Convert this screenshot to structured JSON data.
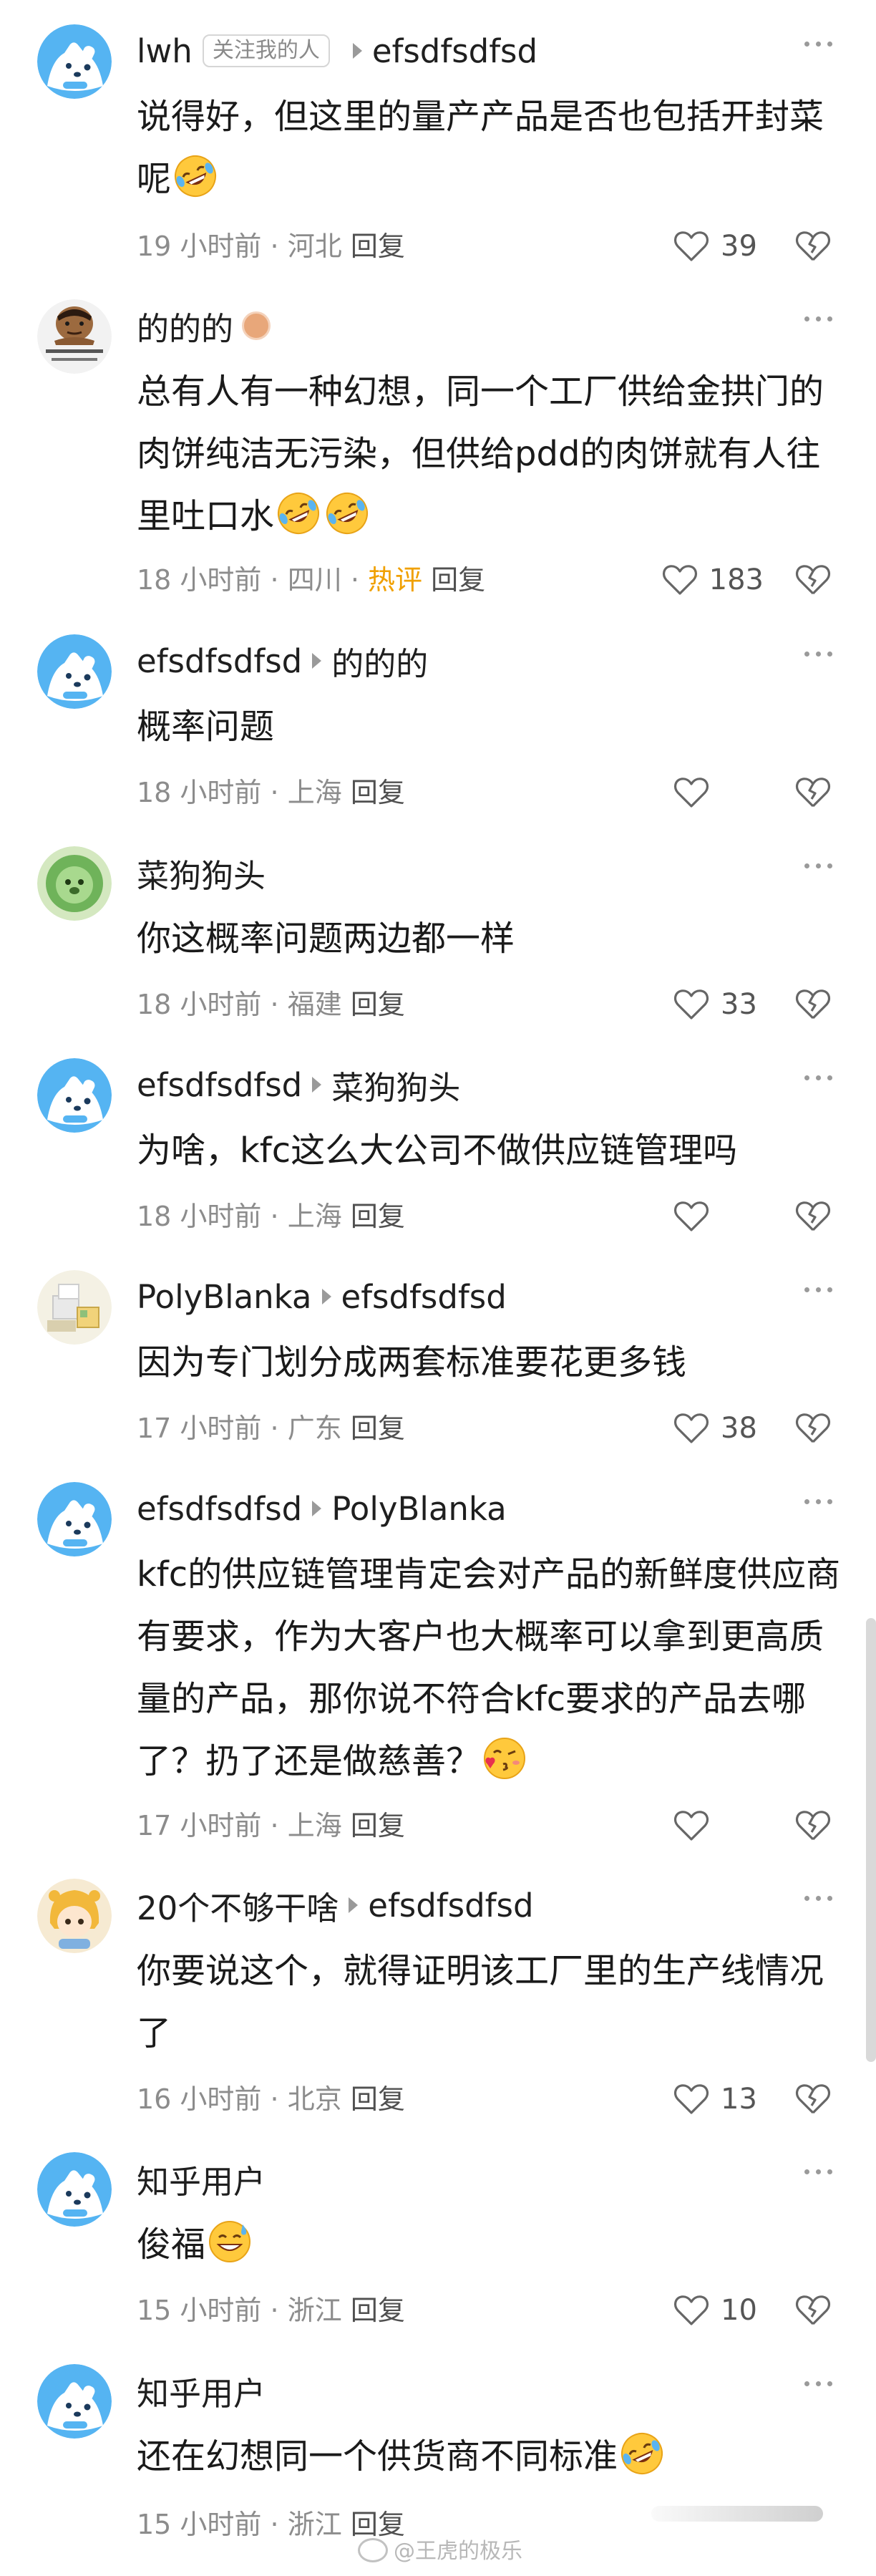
{
  "comments": [
    {
      "avatar": "cartoon-dog-avatar",
      "user": "lwh",
      "badge": "关注我的人",
      "reply_to": "efsdfsdfsd",
      "text": "说得好，但这里的量产产品是否也包括开封菜呢",
      "emoji_after": "rofl-emoji",
      "time": "19 小时前",
      "region": "河北",
      "reply_label": "回复",
      "likes": "39"
    },
    {
      "avatar": "man-meme-avatar",
      "user": "的的的",
      "text": "总有人有一种幻想，同一个工厂供给金拱门的肉饼纯洁无污染，但供给pdd的肉饼就有人往里吐口水",
      "time": "18 小时前",
      "region": "四川",
      "hot_label": "热评",
      "reply_label": "回复",
      "likes": "183"
    },
    {
      "avatar": "cartoon-dog-avatar",
      "user": "efsdfsdfsd",
      "reply_to": "的的的",
      "text": "概率问题",
      "time": "18 小时前",
      "region": "上海",
      "reply_label": "回复",
      "likes": ""
    },
    {
      "avatar": "green-lion-avatar",
      "user": "菜狗狗头",
      "text": "你这概率问题两边都一样",
      "time": "18 小时前",
      "region": "福建",
      "reply_label": "回复",
      "likes": "33"
    },
    {
      "avatar": "cartoon-dog-avatar",
      "user": "efsdfsdfsd",
      "reply_to": "菜狗狗头",
      "text": "为啥，kfc这么大公司不做供应链管理吗",
      "time": "18 小时前",
      "region": "上海",
      "reply_label": "回复",
      "likes": ""
    },
    {
      "avatar": "boxes-avatar",
      "user": "PolyBlanka",
      "reply_to": "efsdfsdfsd",
      "text": "因为专门划分成两套标准要花更多钱",
      "time": "17 小时前",
      "region": "广东",
      "reply_label": "回复",
      "likes": "38"
    },
    {
      "avatar": "cartoon-dog-avatar",
      "user": "efsdfsdfsd",
      "reply_to": "PolyBlanka",
      "text": "kfc的供应链管理肯定会对产品的新鲜度供应商有要求，作为大客户也大概率可以拿到更高质量的产品，那你说不符合kfc要求的产品去哪了？扔了还是做慈善？",
      "emoji_after": "kiss-emoji",
      "time": "17 小时前",
      "region": "上海",
      "reply_label": "回复",
      "likes": ""
    },
    {
      "avatar": "anime-girl-avatar",
      "user": "20个不够干啥",
      "reply_to": "efsdfsdfsd",
      "text": "你要说这个，就得证明该工厂里的生产线情况了",
      "time": "16 小时前",
      "region": "北京",
      "reply_label": "回复",
      "likes": "13"
    },
    {
      "avatar": "cartoon-dog-avatar",
      "user": "知乎用户",
      "text": "俊福",
      "emoji_after": "sweat-smile-emoji",
      "time": "15 小时前",
      "region": "浙江",
      "reply_label": "回复",
      "likes": "10"
    },
    {
      "avatar": "cartoon-dog-avatar",
      "user": "知乎用户",
      "text": "还在幻想同一个供货商不同标准",
      "emoji_after": "rofl-emoji",
      "time": "15 小时前",
      "region": "浙江",
      "reply_label": "回复",
      "likes": ""
    }
  ],
  "separator": "·",
  "watermark": "@王虎的极乐",
  "colors": {
    "hot": "#f0a000",
    "meta": "#8c8c8c",
    "text": "#1a1a1a"
  }
}
